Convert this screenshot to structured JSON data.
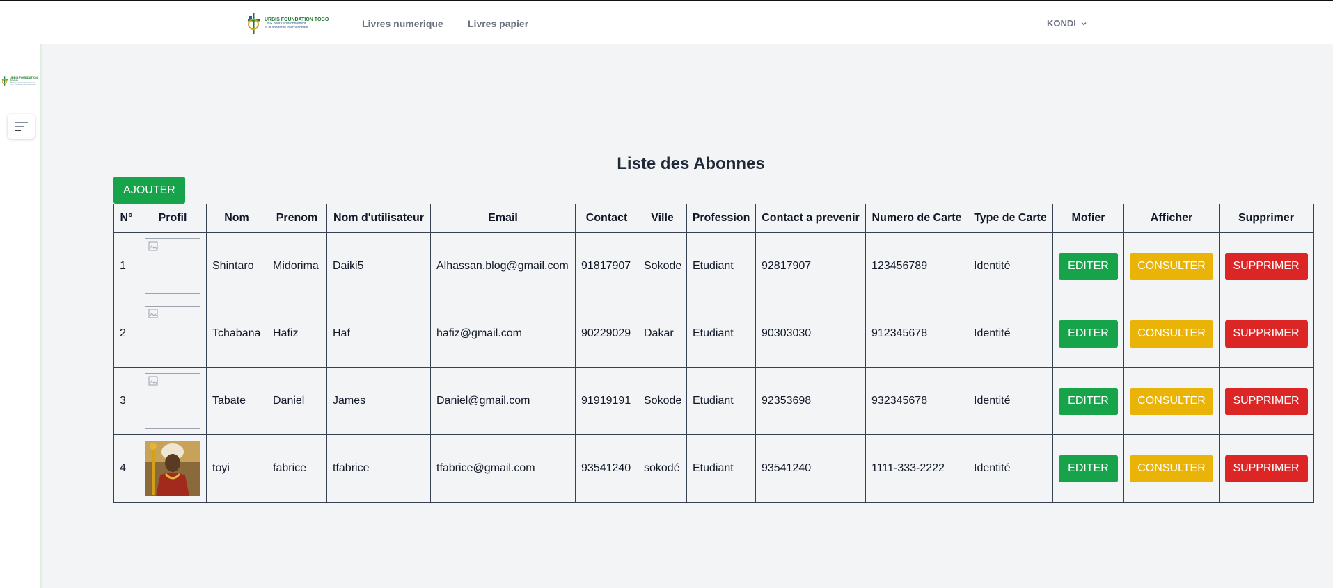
{
  "header": {
    "brand_name": "URBIS FOUNDATION TOGO",
    "brand_sub_1": "ONG pour l'environnement",
    "brand_sub_2": "et la solidarité internationale",
    "nav": [
      "Livres numerique",
      "Livres papier"
    ],
    "user": "KONDI"
  },
  "sidebar": {
    "toggle_icon": "menu-icon"
  },
  "page": {
    "title": "Liste des Abonnes",
    "add_label": "AJOUTER"
  },
  "table": {
    "headers": [
      "N°",
      "Profil",
      "Nom",
      "Prenom",
      "Nom d'utilisateur",
      "Email",
      "Contact",
      "Ville",
      "Profession",
      "Contact a prevenir",
      "Numero de Carte",
      "Type de Carte",
      "Mofier",
      "Afficher",
      "Supprimer"
    ],
    "rows": [
      {
        "num": "1",
        "profile": "broken-image-icon",
        "nom": "Shintaro",
        "prenom": "Midorima",
        "username": "Daiki5",
        "email": "Alhassan.blog@gmail.com",
        "contact": "91817907",
        "ville": "Sokode",
        "profession": "Etudiant",
        "contact_prevenir": "92817907",
        "numero_carte": "123456789",
        "type_carte": "Identité"
      },
      {
        "num": "2",
        "profile": "broken-image-icon",
        "nom": "Tchabana",
        "prenom": "Hafiz",
        "username": "Haf",
        "email": "hafiz@gmail.com",
        "contact": "90229029",
        "ville": "Dakar",
        "profession": "Etudiant",
        "contact_prevenir": "90303030",
        "numero_carte": "912345678",
        "type_carte": "Identité"
      },
      {
        "num": "3",
        "profile": "broken-image-icon",
        "nom": "Tabate",
        "prenom": "Daniel",
        "username": "James",
        "email": "Daniel@gmail.com",
        "contact": "91919191",
        "ville": "Sokode",
        "profession": "Etudiant",
        "contact_prevenir": "92353698",
        "numero_carte": "932345678",
        "type_carte": "Identité"
      },
      {
        "num": "4",
        "profile": "portrait-photo",
        "nom": "toyi",
        "prenom": "fabrice",
        "username": "tfabrice",
        "email": "tfabrice@gmail.com",
        "contact": "93541240",
        "ville": "sokodé",
        "profession": "Etudiant",
        "contact_prevenir": "93541240",
        "numero_carte": "1111-333-2222",
        "type_carte": "Identité"
      }
    ],
    "actions": {
      "edit": "EDITER",
      "view": "CONSULTER",
      "delete": "SUPPRIMER"
    }
  },
  "colors": {
    "edit": "#16a34a",
    "view": "#eab308",
    "delete": "#dc2626",
    "add": "#16a34a"
  }
}
